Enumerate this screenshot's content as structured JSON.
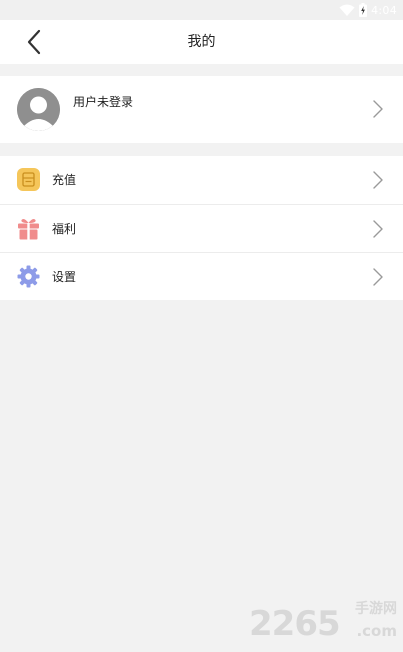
{
  "status_bar": {
    "time": "4:04",
    "icons": [
      "wifi-icon",
      "battery-charging-icon"
    ]
  },
  "header": {
    "title": "我的",
    "back_icon": "back-chevron-icon"
  },
  "user": {
    "name": "用户未登录",
    "avatar_icon": "default-avatar-icon"
  },
  "menu": {
    "items": [
      {
        "label": "充值",
        "icon": "wallet-icon",
        "color": "#f5c65a"
      },
      {
        "label": "福利",
        "icon": "gift-icon",
        "color": "#f08c8c"
      },
      {
        "label": "设置",
        "icon": "gear-icon",
        "color": "#8d9be8"
      }
    ]
  },
  "watermark": {
    "number": "2265",
    "brand_cn": "手游网",
    "domain": ".com"
  },
  "colors": {
    "background": "#f2f2f2",
    "card": "#ffffff",
    "chevron": "#9a9a9a"
  }
}
